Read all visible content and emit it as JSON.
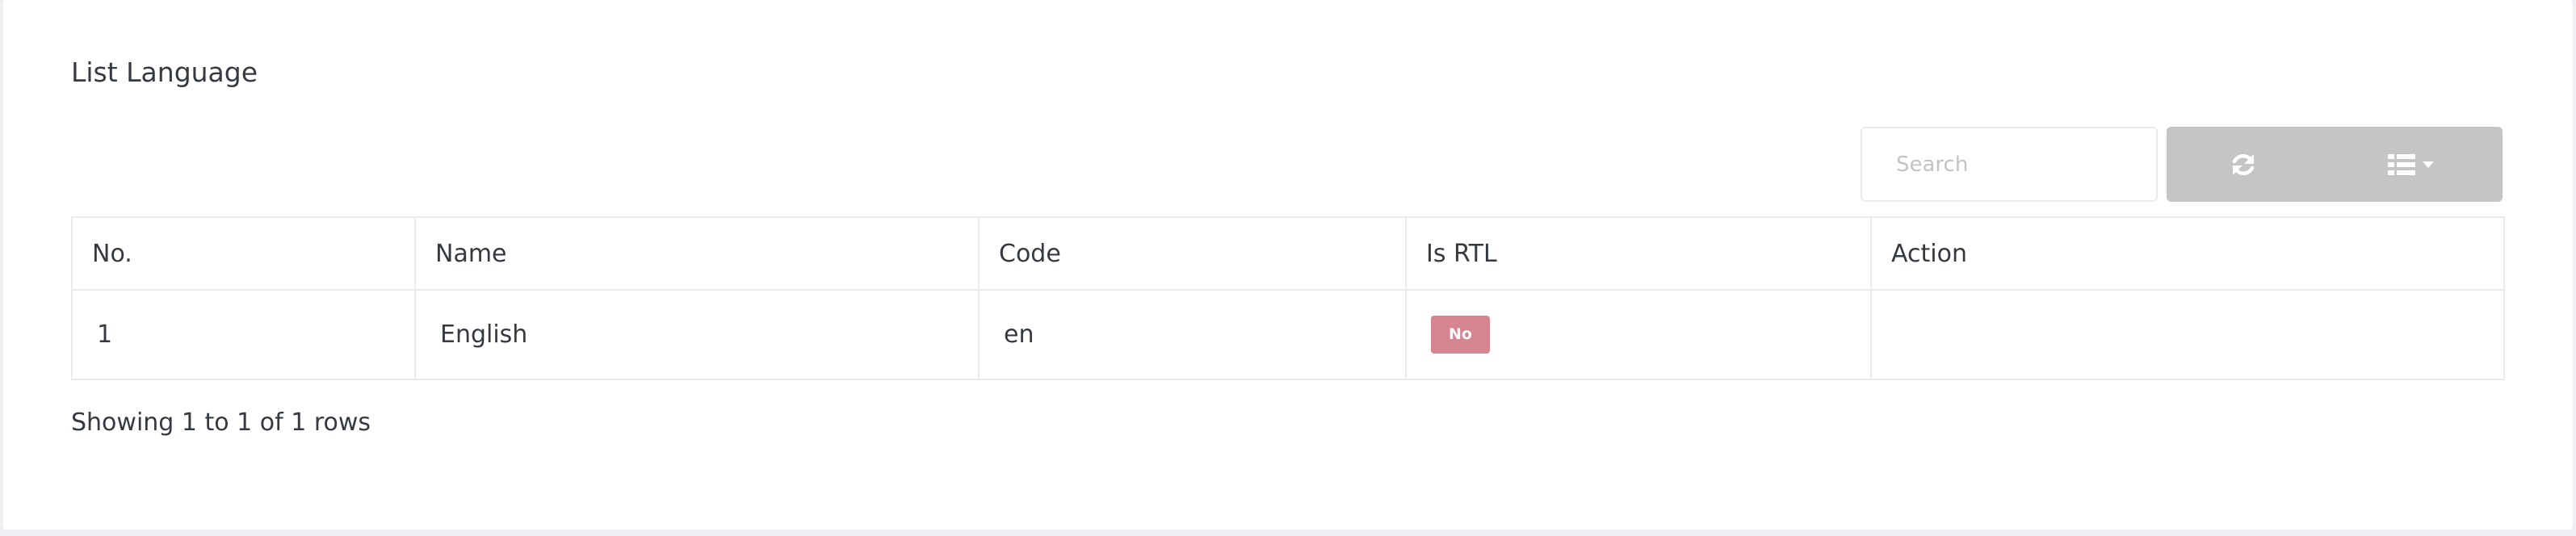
{
  "page": {
    "title": "List Language"
  },
  "toolbar": {
    "search_placeholder": "Search",
    "refresh_icon": "refresh-icon",
    "columns_icon": "list-columns-icon",
    "button_color": "#c6c4c4"
  },
  "table": {
    "headers": {
      "no": "No.",
      "name": "Name",
      "code": "Code",
      "is_rtl": "Is RTL",
      "action": "Action"
    },
    "rows": [
      {
        "no": "1",
        "name": "English",
        "code": "en",
        "is_rtl": "No",
        "action": ""
      }
    ]
  },
  "pagination": {
    "summary": "Showing 1 to 1 of 1 rows"
  },
  "colors": {
    "badge_no": "#d6848f",
    "border": "#e9ecef",
    "text": "#343a40"
  }
}
